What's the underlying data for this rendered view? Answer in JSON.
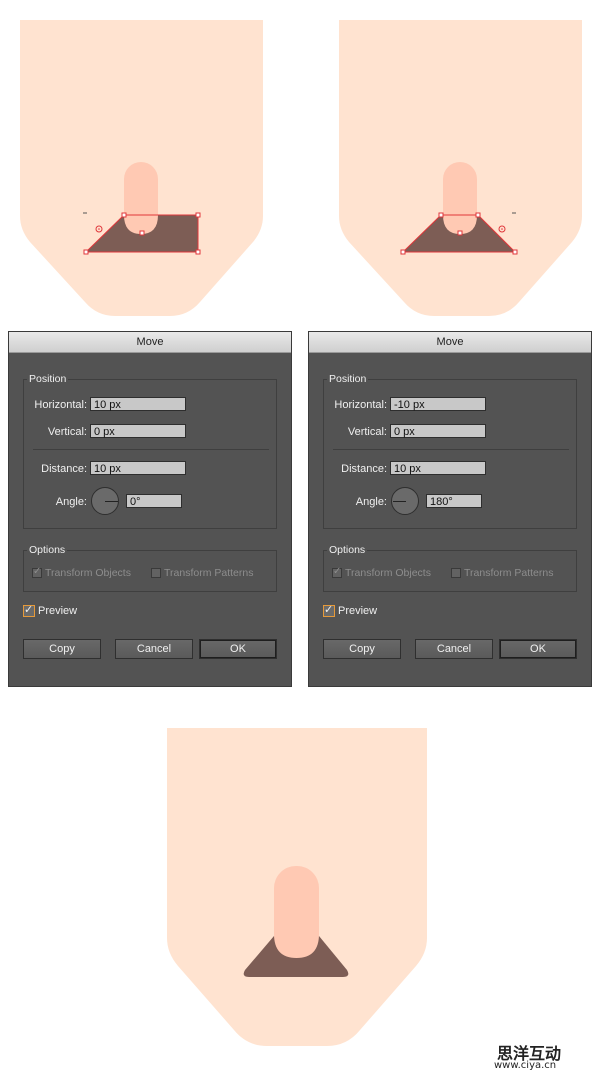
{
  "colors": {
    "skin": "#ffe3d0",
    "finger": "#ffc9b3",
    "brown": "#7d5d55",
    "selection": "#e0363a",
    "dialog_bg": "#535353"
  },
  "dialogs": [
    {
      "title": "Move",
      "position_group": "Position",
      "horizontal_label": "Horizontal:",
      "horizontal_value": "10 px",
      "vertical_label": "Vertical:",
      "vertical_value": "0 px",
      "distance_label": "Distance:",
      "distance_value": "10 px",
      "angle_label": "Angle:",
      "angle_value": "0°",
      "options_group": "Options",
      "transform_objects": "Transform Objects",
      "transform_patterns": "Transform Patterns",
      "preview": "Preview",
      "copy": "Copy",
      "cancel": "Cancel",
      "ok": "OK"
    },
    {
      "title": "Move",
      "position_group": "Position",
      "horizontal_label": "Horizontal:",
      "horizontal_value": "-10 px",
      "vertical_label": "Vertical:",
      "vertical_value": "0 px",
      "distance_label": "Distance:",
      "distance_value": "10 px",
      "angle_label": "Angle:",
      "angle_value": "180°",
      "options_group": "Options",
      "transform_objects": "Transform Objects",
      "transform_patterns": "Transform Patterns",
      "preview": "Preview",
      "copy": "Copy",
      "cancel": "Cancel",
      "ok": "OK"
    }
  ],
  "watermark": {
    "name": "思洋互动",
    "url": "www.ciya.cn"
  }
}
